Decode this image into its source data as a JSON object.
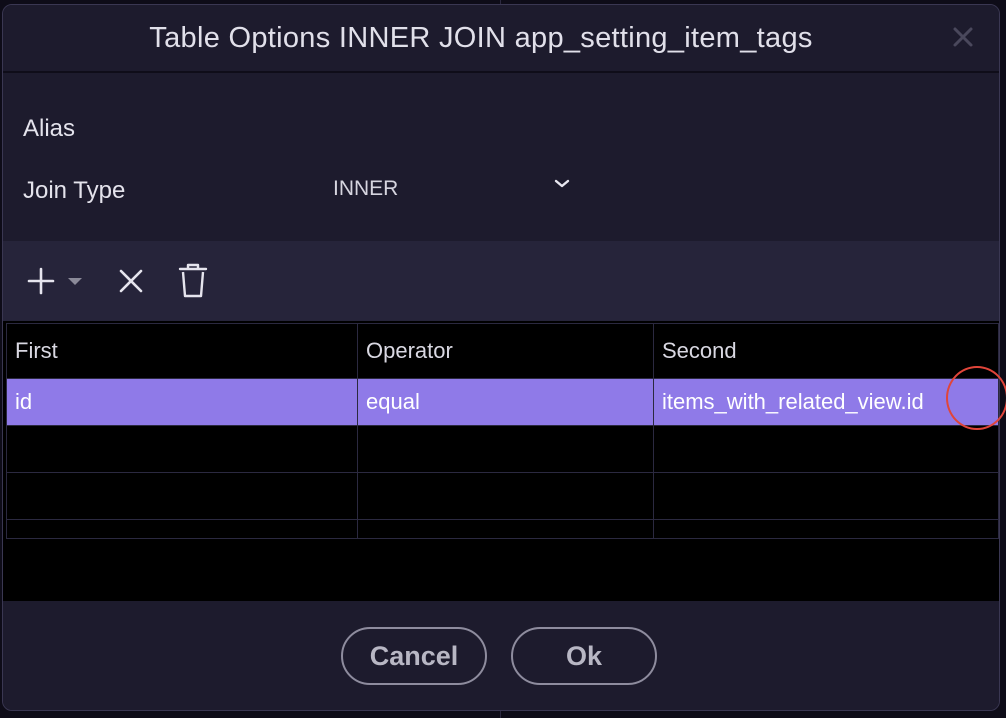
{
  "dialog": {
    "title": "Table Options INNER JOIN app_setting_item_tags",
    "close_icon": "close-icon"
  },
  "form": {
    "alias_label": "Alias",
    "alias_value": "",
    "join_type_label": "Join Type",
    "join_type_value": "INNER",
    "join_type_icon": "chevron-down-icon"
  },
  "toolbar": {
    "add_icon": "plus-icon",
    "add_dropdown_icon": "caret-down-icon",
    "remove_icon": "x-icon",
    "delete_icon": "trash-icon"
  },
  "table": {
    "columns": [
      "First",
      "Operator",
      "Second"
    ],
    "rows": [
      {
        "first": "id",
        "operator": "equal",
        "second": "items_with_related_view.id",
        "selected": true
      },
      {
        "first": "",
        "operator": "",
        "second": "",
        "selected": false
      },
      {
        "first": "",
        "operator": "",
        "second": "",
        "selected": false
      },
      {
        "first": "",
        "operator": "",
        "second": "",
        "selected": false
      }
    ]
  },
  "buttons": {
    "cancel": "Cancel",
    "ok": "Ok"
  },
  "colors": {
    "selected_row": "#8f7ae8",
    "dialog_bg": "#1d1b2d",
    "toolbar_bg": "#26243a",
    "annotation_circle": "#e0453a"
  }
}
